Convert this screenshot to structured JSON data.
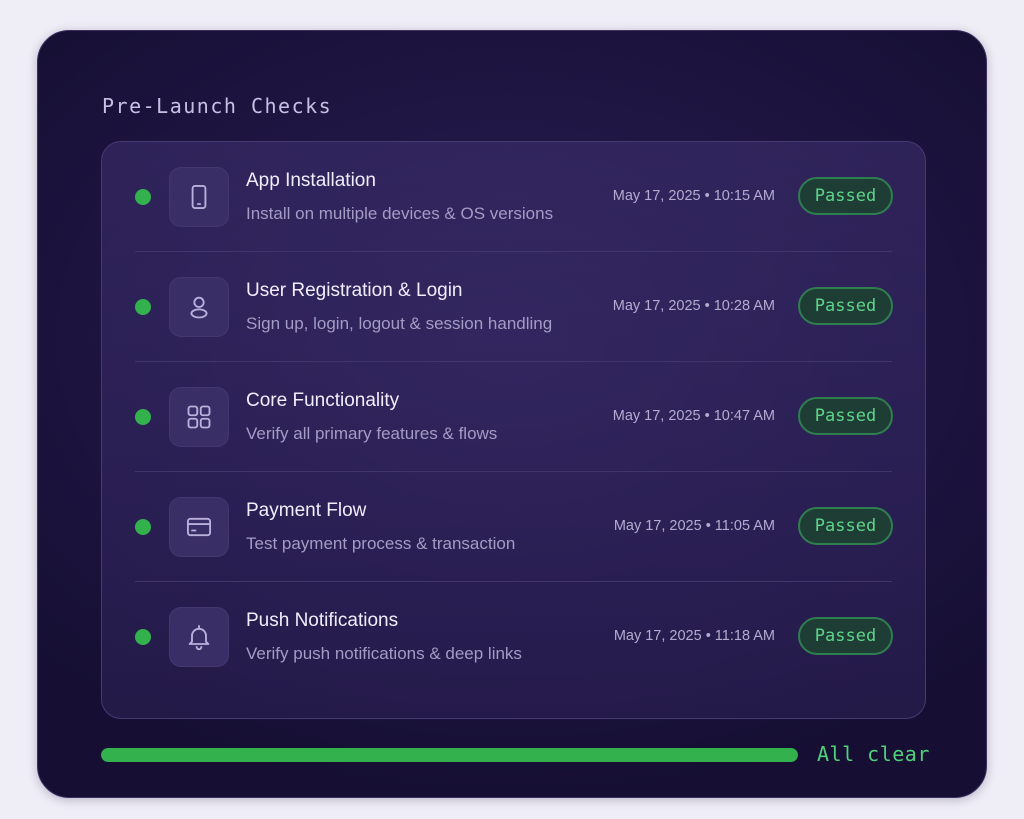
{
  "section_title": "Pre-Launch Checks",
  "checks": [
    {
      "title": "App Installation",
      "description": "Install on multiple devices & OS versions",
      "timestamp": "May 17, 2025 • 10:15 AM",
      "status": "Passed",
      "icon": "smartphone-icon"
    },
    {
      "title": "User Registration & Login",
      "description": "Sign up, login, logout & session handling",
      "timestamp": "May 17, 2025 • 10:28 AM",
      "status": "Passed",
      "icon": "user-icon"
    },
    {
      "title": "Core Functionality",
      "description": "Verify all primary features & flows",
      "timestamp": "May 17, 2025 • 10:47 AM",
      "status": "Passed",
      "icon": "apps-grid-icon"
    },
    {
      "title": "Payment Flow",
      "description": "Test payment process & transaction",
      "timestamp": "May 17, 2025 • 11:05 AM",
      "status": "Passed",
      "icon": "credit-card-icon"
    },
    {
      "title": "Push Notifications",
      "description": "Verify push notifications & deep links",
      "timestamp": "May 17, 2025 • 11:18 AM",
      "status": "Passed",
      "icon": "bell-icon"
    }
  ],
  "progress": {
    "value": 1.0,
    "label": "All clear"
  },
  "colors": {
    "panel_background": "#1e1542",
    "card_background": "#32265e",
    "status_dot": "#33b14d",
    "badge_text": "#5fd58a",
    "badge_border": "#2f7e50",
    "progress_fill": "#33b14d"
  }
}
